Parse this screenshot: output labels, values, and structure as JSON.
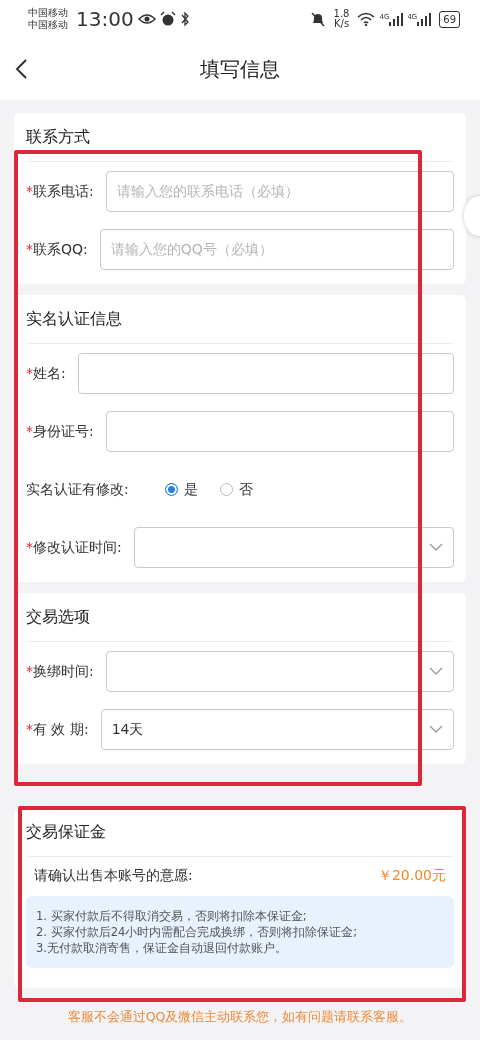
{
  "status_bar": {
    "carriers": [
      "中国移动",
      "中国移动"
    ],
    "time": "13:00",
    "net_speed": [
      "1.8",
      "K/s"
    ],
    "network_types": [
      "4G",
      "4G"
    ],
    "battery": "69"
  },
  "header": {
    "title": "填写信息"
  },
  "sections": [
    {
      "title": "联系方式",
      "fields": [
        {
          "kind": "input",
          "required_mark": "*",
          "label": "联系电话:",
          "placeholder": "请输入您的联系电话（必填）"
        },
        {
          "kind": "input",
          "required_mark": "*",
          "label": "联系QQ:",
          "placeholder": "请输入您的QQ号（必填）"
        }
      ]
    },
    {
      "title": "实名认证信息",
      "fields": [
        {
          "kind": "input",
          "required_mark": "*",
          "label": "姓名:"
        },
        {
          "kind": "input",
          "required_mark": "*",
          "label": "身份证号:"
        },
        {
          "kind": "radio",
          "label": "实名认证有修改:",
          "options": [
            {
              "label": "是",
              "selected": true
            },
            {
              "label": "否",
              "selected": false
            }
          ]
        },
        {
          "kind": "select",
          "required_mark": "*",
          "label": "修改认证时间:"
        }
      ]
    },
    {
      "title": "交易选项",
      "fields": [
        {
          "kind": "select",
          "required_mark": "*",
          "label": "换绑时间:"
        },
        {
          "kind": "select",
          "required_mark": "*",
          "label": "有 效 期:",
          "value": "14天"
        }
      ]
    }
  ],
  "deposit": {
    "title": "交易保证金",
    "prompt": "请确认出售本账号的意愿:",
    "amount": "￥20.00元",
    "rules": [
      "1. 买家付款后不得取消交易，否则将扣除本保证金;",
      "2. 买家付款后24小时内需配合完成换绑，否则将扣除保证金;",
      "3.无付款取消寄售，保证金自动退回付款账户。"
    ]
  },
  "notice": "客服不会通过QQ及微信主动联系您，如有问题请联系客服。"
}
